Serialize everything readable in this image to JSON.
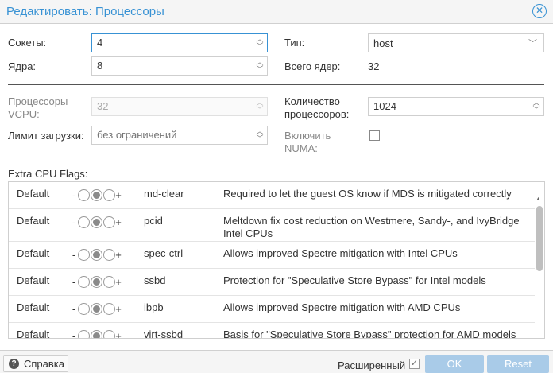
{
  "dialog": {
    "title": "Редактировать: Процессоры"
  },
  "form": {
    "sockets": {
      "label": "Сокеты:",
      "value": "4"
    },
    "cores": {
      "label": "Ядра:",
      "value": "8"
    },
    "type": {
      "label": "Тип:",
      "value": "host"
    },
    "total_cores": {
      "label": "Всего ядер:",
      "value": "32"
    },
    "vcpus": {
      "label_line1": "Процессоры",
      "label_line2": "VCPU:",
      "value": "32"
    },
    "cpu_units": {
      "label_line1": "Количество",
      "label_line2": "процессоров:",
      "value": "1024"
    },
    "cpu_limit": {
      "label": "Лимит загрузки:",
      "placeholder": "без ограничений"
    },
    "numa": {
      "label_line1": "Включить",
      "label_line2": "NUMA:",
      "checked": false
    }
  },
  "flags": {
    "label": "Extra CPU Flags:",
    "rows": [
      {
        "default": "Default",
        "minus": "-",
        "plus": "+",
        "flag": "md-clear",
        "desc": "Required to let the guest OS know if MDS is mitigated correctly"
      },
      {
        "default": "Default",
        "minus": "-",
        "plus": "+",
        "flag": "pcid",
        "desc": "Meltdown fix cost reduction on Westmere, Sandy-, and IvyBridge Intel CPUs"
      },
      {
        "default": "Default",
        "minus": "-",
        "plus": "+",
        "flag": "spec-ctrl",
        "desc": "Allows improved Spectre mitigation with Intel CPUs"
      },
      {
        "default": "Default",
        "minus": "-",
        "plus": "+",
        "flag": "ssbd",
        "desc": "Protection for \"Speculative Store Bypass\" for Intel models"
      },
      {
        "default": "Default",
        "minus": "-",
        "plus": "+",
        "flag": "ibpb",
        "desc": "Allows improved Spectre mitigation with AMD CPUs"
      },
      {
        "default": "Default",
        "minus": "-",
        "plus": "+",
        "flag": "virt-ssbd",
        "desc": "Basis for \"Speculative Store Bypass\" protection for AMD models"
      }
    ]
  },
  "footer": {
    "help": "Справка",
    "advanced": "Расширенный",
    "advanced_checked": true,
    "ok": "OK",
    "reset": "Reset"
  },
  "colors": {
    "accent": "#3892d4",
    "button_disabled": "#a9cbe8"
  }
}
